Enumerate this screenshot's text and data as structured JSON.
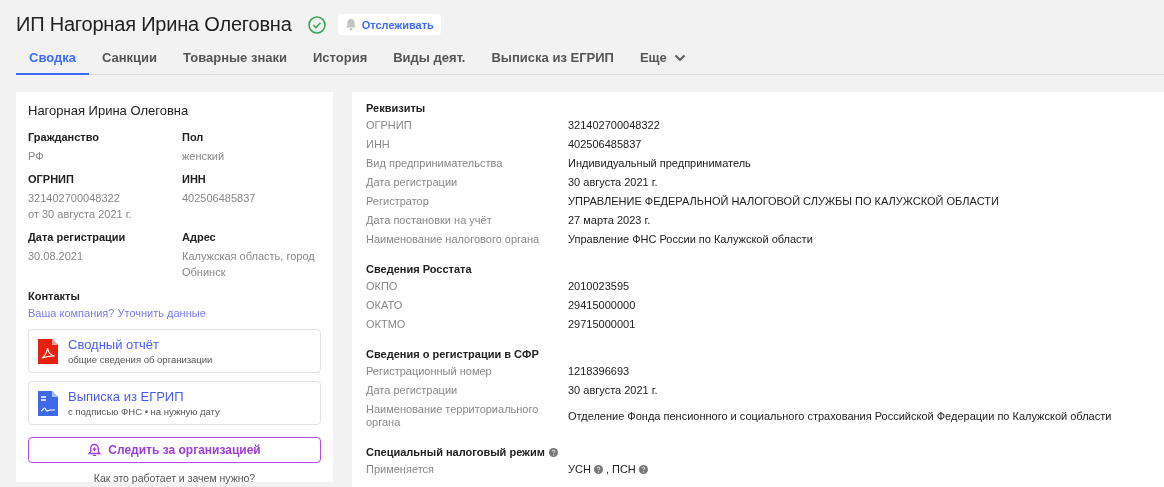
{
  "header": {
    "title": "ИП Нагорная Ирина Олеговна",
    "verified": true,
    "track_button": "Отслеживать"
  },
  "tabs": [
    {
      "label": "Сводка",
      "selected": true
    },
    {
      "label": "Санкции",
      "selected": false
    },
    {
      "label": "Товарные знаки",
      "selected": false
    },
    {
      "label": "История",
      "selected": false
    },
    {
      "label": "Виды деят.",
      "selected": false
    },
    {
      "label": "Выписка из ЕГРИП",
      "selected": false
    },
    {
      "label": "Еще",
      "selected": false,
      "dropdown": true
    }
  ],
  "summary_card": {
    "name": "Нагорная Ирина Олеговна",
    "fields": [
      {
        "label": "Гражданство",
        "value": [
          "РФ"
        ]
      },
      {
        "label": "Пол",
        "value": [
          "женский"
        ]
      },
      {
        "label": "ОГРНИП",
        "value": [
          "321402700048322",
          "от 30 августа 2021 г."
        ]
      },
      {
        "label": "ИНН",
        "value": [
          "402506485837"
        ]
      },
      {
        "label": "Дата регистрации",
        "value": [
          "30.08.2021"
        ]
      },
      {
        "label": "Адрес",
        "value": [
          "Калужская область, город",
          "Обнинск"
        ]
      }
    ],
    "contacts_heading": "Контакты",
    "contacts_link": "Ваша компания? Уточнить данные",
    "documents": [
      {
        "kind": "pdf",
        "title": "Сводный отчёт",
        "subtitle": "общие сведения об организации"
      },
      {
        "kind": "doc",
        "title": "Выписка из ЕГРИП",
        "subtitle": "с подписью ФНС • на нужную дату"
      }
    ],
    "follow_button": "Следить за организацией",
    "help_link": "Как это работает и зачем нужно?"
  },
  "details": [
    {
      "heading": "Реквизиты",
      "rows": [
        {
          "label": "ОГРНИП",
          "value": [
            {
              "text": "321402700048322"
            }
          ]
        },
        {
          "label": "ИНН",
          "value": [
            {
              "text": "402506485837"
            }
          ]
        },
        {
          "label": "Вид предпринимательства",
          "value": [
            {
              "text": "Индивидуальный предприниматель"
            }
          ]
        },
        {
          "label": "Дата регистрации",
          "value": [
            {
              "text": "30 августа 2021 г."
            }
          ]
        },
        {
          "label": "Регистратор",
          "value": [
            {
              "text": "УПРАВЛЕНИЕ ФЕДЕРАЛЬНОЙ НАЛОГОВОЙ СЛУЖБЫ ПО КАЛУЖСКОЙ ОБЛАСТИ"
            }
          ]
        },
        {
          "label": "Дата постановки на учёт",
          "value": [
            {
              "text": "27 марта 2023 г."
            }
          ]
        },
        {
          "label": "Наименование налогового органа",
          "value": [
            {
              "text": "Управление ФНС России по Калужской области"
            }
          ]
        }
      ]
    },
    {
      "heading": "Сведения Росстата",
      "rows": [
        {
          "label": "ОКПО",
          "value": [
            {
              "text": "2010023595"
            }
          ]
        },
        {
          "label": "ОКАТО",
          "value": [
            {
              "text": "29415000000"
            }
          ]
        },
        {
          "label": "ОКТМО",
          "value": [
            {
              "text": "29715000001"
            }
          ]
        }
      ]
    },
    {
      "heading": "Сведения о регистрации в СФР",
      "rows": [
        {
          "label": "Регистрационный номер",
          "value": [
            {
              "text": "1218396693"
            }
          ]
        },
        {
          "label": "Дата регистрации",
          "value": [
            {
              "text": "30 августа 2021 г."
            }
          ]
        },
        {
          "label": "Наименование территориального органа",
          "value": [
            {
              "text": "Отделение Фонда пенсионного и социального страхования Российской Федерации по Калужской области"
            }
          ]
        }
      ]
    },
    {
      "heading": "Специальный налоговый режим",
      "help": true,
      "rows": [
        {
          "label": "Применяется",
          "value": [
            {
              "text": "УСН",
              "help": true
            },
            {
              "text": ", ПСН",
              "help": true
            }
          ]
        }
      ]
    }
  ]
}
